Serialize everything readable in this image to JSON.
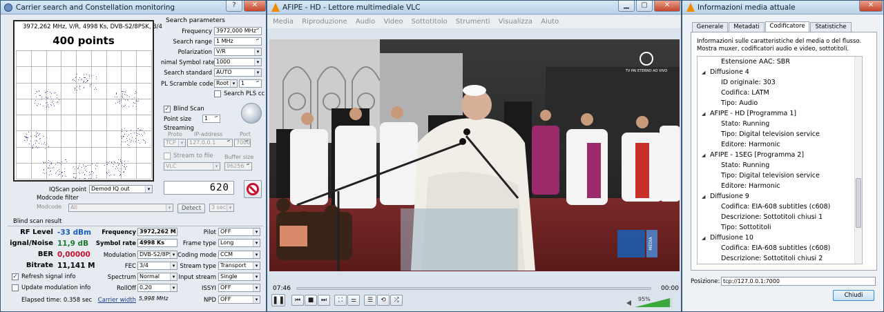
{
  "left_window": {
    "title": "Carrier search and Constellation monitoring",
    "help_btn": "?",
    "close_btn": "✕",
    "plot_header": "3972,262 MHz, V/R, 4998 Ks, DVB-S2/8PSK, 3/4",
    "points": "400 points",
    "search_params_title": "Search parameters",
    "frequency_label": "Frequency",
    "frequency_value": "3972,000 MHz",
    "search_range_label": "Search range",
    "search_range_value": "1 MHz",
    "polarization_label": "Polarization",
    "polarization_value": "V/R",
    "min_symbol_label": "nimal Symbol rate",
    "min_symbol_value": "1000",
    "search_standard_label": "Search standard",
    "search_standard_value": "AUTO",
    "pl_scramble_label": "PL Scramble code",
    "pl_scramble_value": "Root",
    "pl_scramble_num": "1",
    "search_pls_label": "Search PLS cc",
    "blind_scan_label": "Blind Scan",
    "point_size_label": "Point size",
    "point_size_value": "1",
    "streaming_label": "Streaming",
    "proto_label": "Proto",
    "ip_label": "IP-address",
    "port_label": "Port",
    "proto_value": "TCP",
    "ip_value": "127.0.0.1",
    "port_value": "7000",
    "stream_to_file_label": "Stream to file",
    "buffer_size_label": "Buffer size",
    "player_value": "VLC",
    "buffer_value": "96256",
    "counter": "620",
    "iqscan_label": "IQScan point",
    "iqscan_value": "Demod IQ out",
    "modcode_filter_label": "Modcode filter",
    "modcode_label": "Modcode",
    "modcode_value": "All",
    "detect_btn": "Detect",
    "sec_value": "3 sec",
    "result_title": "Blind scan result",
    "rf_label": "RF Level",
    "rf_value": "-33 dBm",
    "sn_label": "ignal/Noise",
    "sn_value": "11,9 dB",
    "ber_label": "BER",
    "ber_value": "0,00000",
    "bitrate_label": "Bitrate",
    "bitrate_value": "11,141 M",
    "res_freq_label": "Frequency",
    "res_freq_value": "3972,262 M",
    "res_sr_label": "Symbol rate",
    "res_sr_value": "4998 Ks",
    "modulation_label": "Modulation",
    "modulation_value": "DVB-S2/8PS",
    "fec_label": "FEC",
    "fec_value": "3/4",
    "spectrum_label": "Spectrum",
    "spectrum_value": "Normal",
    "rolloff_label": "RollOff",
    "rolloff_value": "0.20",
    "carrier_width_label": "Carrier width",
    "carrier_width_value": "5,998 MHz",
    "pilot_label": "Pilot",
    "pilot_value": "OFF",
    "frame_type_label": "Frame type",
    "frame_type_value": "Long",
    "coding_mode_label": "Coding mode",
    "coding_mode_value": "CCM",
    "stream_type_label": "Stream type",
    "stream_type_value": "Transport",
    "input_stream_label": "Input stream",
    "input_stream_value": "Single",
    "issyi_label": "ISSYI",
    "issyi_value": "OFF",
    "npd_label": "NPD",
    "npd_value": "OFF",
    "refresh_label": "Refresh signal info",
    "update_mod_label": "Update modulation info",
    "elapsed": "Elapsed time: 0.358 sec"
  },
  "vlc": {
    "title": "AFIPE - HD - Lettore multimediale VLC",
    "menu": [
      "Media",
      "Riproduzione",
      "Audio",
      "Video",
      "Sottotitolo",
      "Strumenti",
      "Visualizza",
      "Aiuto"
    ],
    "time_elapsed": "07:46",
    "time_total": "00:00",
    "overlay_channel": "TV PAI ETERNO AO VIVO",
    "overlay_brand": "MEDIA",
    "volume": "95%",
    "controls": {
      "play": "❚❚",
      "prev": "⏮",
      "stop": "■",
      "next": "⏭",
      "fullscreen": "⛶",
      "ext": "⚌",
      "playlist": "☰",
      "loop": "⟲",
      "shuffle": "⤮"
    }
  },
  "info": {
    "title": "Informazioni media attuale",
    "tabs": [
      "Generale",
      "Metadati",
      "Codificatore",
      "Statistiche"
    ],
    "description": "Informazioni sulle caratteristiche del media o del flusso. Mostra muxer, codificatori audio e video, sottotitoli.",
    "tree": {
      "l0": "Estensione AAC: SBR",
      "l1": "Diffusione 4",
      "l2": "ID originale: 303",
      "l3": "Codifica: LATM",
      "l4": "Tipo: Audio",
      "l5": "AFIPE - HD [Programma 1]",
      "l6": "Stato: Running",
      "l7": "Tipo: Digital television service",
      "l8": "Editore: Harmonic",
      "l9": "AFIPE - 1SEG [Programma 2]",
      "l10": "Stato: Running",
      "l11": "Tipo: Digital television service",
      "l12": "Editore: Harmonic",
      "l13": "Diffusione 9",
      "l14": "Codifica: EIA-608 subtitles (c608)",
      "l15": "Descrizione: Sottotitoli chiusi 1",
      "l16": "Tipo: Sottotitoli",
      "l17": "Diffusione 10",
      "l18": "Codifica: EIA-608 subtitles (c608)",
      "l19": "Descrizione: Sottotitoli chiusi 2"
    },
    "position_label": "Posizione:",
    "position_value": "tcp://127.0.0.1:7000",
    "close_btn": "Chiudi"
  },
  "colors": {
    "accent_blue": "#1a5fb4",
    "danger_red": "#c8102e",
    "sn_green": "#1a7a2a"
  }
}
